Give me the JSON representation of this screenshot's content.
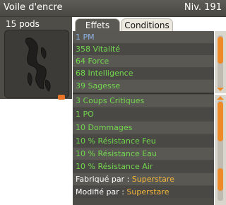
{
  "header": {
    "title": "Voile d'encre",
    "level": "Niv. 191"
  },
  "item": {
    "weight": "15 pods"
  },
  "tabs": [
    {
      "label": "Effets"
    },
    {
      "label": "Conditions"
    }
  ],
  "effects_top": [
    {
      "text": "1 PM",
      "color": "blue"
    },
    {
      "text": "358 Vitalité",
      "color": "green"
    },
    {
      "text": "64 Force",
      "color": "green"
    },
    {
      "text": "68 Intelligence",
      "color": "green"
    },
    {
      "text": "39 Sagesse",
      "color": "green"
    }
  ],
  "effects_bottom": [
    {
      "text": "3 Coups Critiques",
      "color": "green"
    },
    {
      "text": "1 PO",
      "color": "green"
    },
    {
      "text": "10 Dommages",
      "color": "green"
    },
    {
      "text": "10 % Résistance Feu",
      "color": "green"
    },
    {
      "text": "10 % Résistance Eau",
      "color": "green"
    },
    {
      "text": "10 % Résistance Air",
      "color": "green"
    }
  ],
  "crafted": {
    "prefix": "Fabriqué par : ",
    "name": "Superstare"
  },
  "modified": {
    "prefix": "Modifié par : ",
    "name": "Superstare"
  },
  "colors": {
    "accent": "#ef8a28",
    "effect_green": "#72d84e",
    "effect_blue": "#8fb2e6",
    "name_gold": "#f6b83a"
  }
}
